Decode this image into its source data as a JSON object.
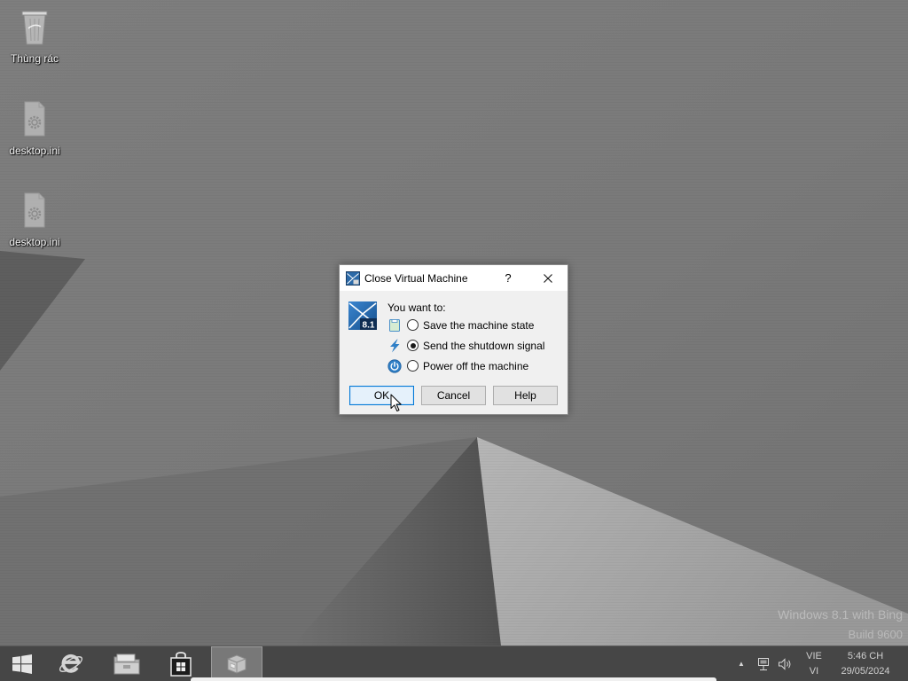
{
  "desktop": {
    "icons": [
      {
        "label": "Thùng rác",
        "icon": "recycle-bin-icon"
      },
      {
        "label": "desktop.ini",
        "icon": "settings-file-icon"
      },
      {
        "label": "desktop.ini",
        "icon": "settings-file-icon"
      }
    ],
    "watermark": {
      "line1": "Windows 8.1 with Bing",
      "line2": "Build 9600"
    }
  },
  "dialog": {
    "title": "Close Virtual Machine",
    "title_icon": "virtualbox-vm-icon",
    "help_glyph": "?",
    "close_icon": "close-icon",
    "os_badge": "8.1",
    "prompt": "You want to:",
    "options": [
      {
        "label": "Save the machine state",
        "icon": "save-state-icon",
        "selected": false
      },
      {
        "label": "Send the shutdown signal",
        "icon": "shutdown-signal-icon",
        "selected": true
      },
      {
        "label": "Power off the machine",
        "icon": "power-off-icon",
        "selected": false
      }
    ],
    "buttons": [
      {
        "label": "OK",
        "focused": true
      },
      {
        "label": "Cancel",
        "focused": false
      },
      {
        "label": "Help",
        "focused": false
      }
    ]
  },
  "cursor": {
    "icon": "mouse-pointer-icon"
  },
  "taskbar": {
    "start_icon": "windows-start-icon",
    "pinned": [
      {
        "icon": "internet-explorer-icon",
        "active": false
      },
      {
        "icon": "file-explorer-icon",
        "active": false
      },
      {
        "icon": "store-icon",
        "active": false
      },
      {
        "icon": "virtualbox-app-icon",
        "active": true
      }
    ],
    "tray": {
      "overflow_glyph": "▲",
      "network_icon": "network-icon",
      "volume_icon": "volume-icon",
      "input_language": "VIE",
      "keyboard_layout": "VI",
      "time": "5:46 CH",
      "date": "29/05/2024"
    }
  },
  "colors": {
    "accent": "#0078d7",
    "taskbar": "#464646",
    "dialog_body": "#f0f0f0",
    "icon_blue": "#2f7fc6"
  }
}
